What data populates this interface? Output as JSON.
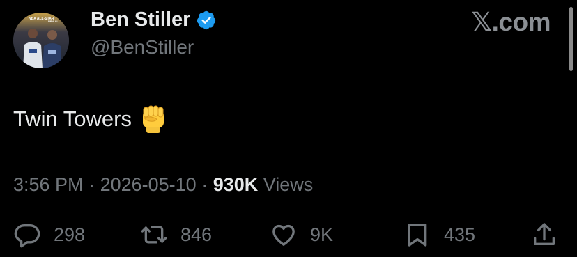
{
  "author": {
    "display_name": "Ben Stiller",
    "handle": "@BenStiller",
    "verified_badge_icon": "verified-check-icon",
    "verified_color": "#1d9bf0",
    "avatar_banner_text": [
      "NBA ALL-STAR",
      "NBA ALL-S"
    ]
  },
  "brand": {
    "label": "𝕏.com"
  },
  "tweet": {
    "text": "Twin Towers",
    "emoji_icon": "raised-fist-icon"
  },
  "meta": {
    "time": "3:56 PM",
    "separator1": " · ",
    "date": "2026-05-10",
    "separator2": " · ",
    "views_count": "930K",
    "views_label": " Views"
  },
  "actions": {
    "reply_count": "298",
    "retweet_count": "846",
    "like_count": "9K",
    "bookmark_count": "435"
  },
  "colors": {
    "background": "#000000",
    "primary_text": "#e7e9ea",
    "secondary_text": "#71767b"
  }
}
